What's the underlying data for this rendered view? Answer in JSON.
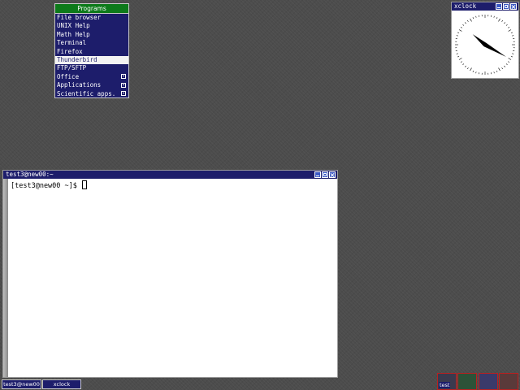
{
  "menu": {
    "title": "Programs",
    "items": [
      {
        "label": "File browser"
      },
      {
        "label": "UNIX Help"
      },
      {
        "label": "Math Help"
      },
      {
        "label": "Terminal"
      },
      {
        "label": "Firefox"
      },
      {
        "label": "Thunderbird",
        "selected": true
      },
      {
        "label": "FTP/SFTP"
      },
      {
        "label": "Office",
        "submenu": true
      },
      {
        "label": "Applications",
        "submenu": true
      },
      {
        "label": "Scientific apps.",
        "submenu": true
      }
    ]
  },
  "xclock": {
    "title": "xclock",
    "time": {
      "hour": 10,
      "minute": 20
    }
  },
  "terminal": {
    "title": "test3@new00:~",
    "prompt": "[test3@new00 ~]$ "
  },
  "taskbar": {
    "tasks": [
      {
        "label": "test3@new00"
      },
      {
        "label": "xclock"
      }
    ]
  },
  "pager": {
    "desktops": [
      {
        "label": "test",
        "color": "#3a3a4e",
        "active": true
      },
      {
        "label": "",
        "color": "#2c5238"
      },
      {
        "label": "",
        "color": "#3a3a6a"
      },
      {
        "label": "",
        "color": "#5a3a3a"
      }
    ]
  },
  "colors": {
    "titlebar": "#1d1d6b",
    "menu_header": "#0d7a1a",
    "desktop": "#4c4c4c"
  }
}
